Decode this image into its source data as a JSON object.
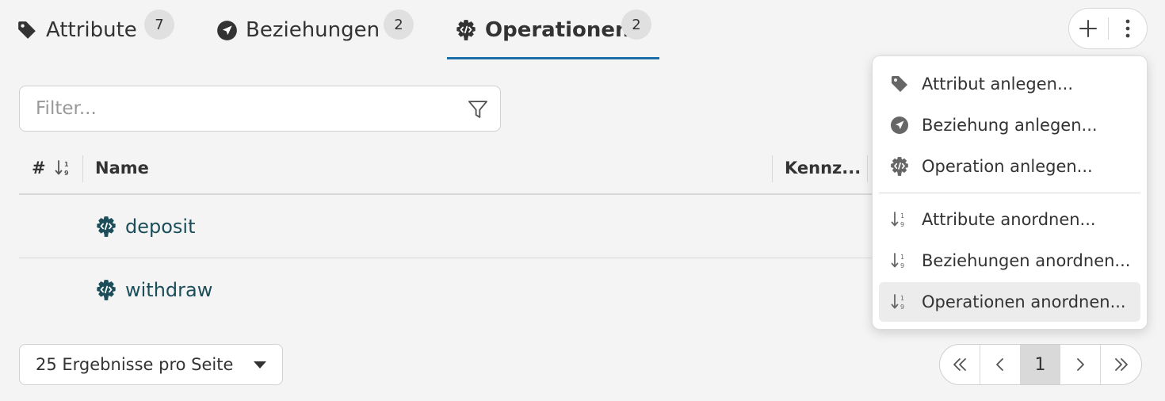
{
  "tabs": [
    {
      "label": "Attribute",
      "count": "7",
      "icon": "tag-icon",
      "active": false
    },
    {
      "label": "Beziehungen",
      "count": "2",
      "icon": "navigation-arrow-icon",
      "active": false
    },
    {
      "label": "Operationen",
      "count": "2",
      "icon": "code-gear-icon",
      "active": true
    }
  ],
  "actions": {
    "add_icon": "plus-icon",
    "more_icon": "kebab-menu-icon"
  },
  "filter": {
    "placeholder": "Filter..."
  },
  "table": {
    "columns": {
      "index": "#",
      "name": "Name",
      "kennz": "Kennz..."
    },
    "rows": [
      {
        "name": "deposit",
        "icon": "code-gear-icon"
      },
      {
        "name": "withdraw",
        "icon": "code-gear-icon"
      }
    ]
  },
  "pagination": {
    "per_page_label": "25 Ergebnisse pro Seite",
    "current_page": "1"
  },
  "menu": {
    "items": [
      {
        "label": "Attribut anlegen...",
        "icon": "tag-icon"
      },
      {
        "label": "Beziehung anlegen...",
        "icon": "navigation-arrow-icon"
      },
      {
        "label": "Operation anlegen...",
        "icon": "code-gear-icon"
      },
      {
        "label": "Attribute anordnen...",
        "icon": "sort-numeric-icon"
      },
      {
        "label": "Beziehungen anordnen...",
        "icon": "sort-numeric-icon"
      },
      {
        "label": "Operationen anordnen...",
        "icon": "sort-numeric-icon",
        "highlighted": true
      }
    ]
  },
  "colors": {
    "accent": "#1a6fa8",
    "link": "#1b4e5a",
    "icon": "#333333",
    "menu_icon": "#666666"
  }
}
